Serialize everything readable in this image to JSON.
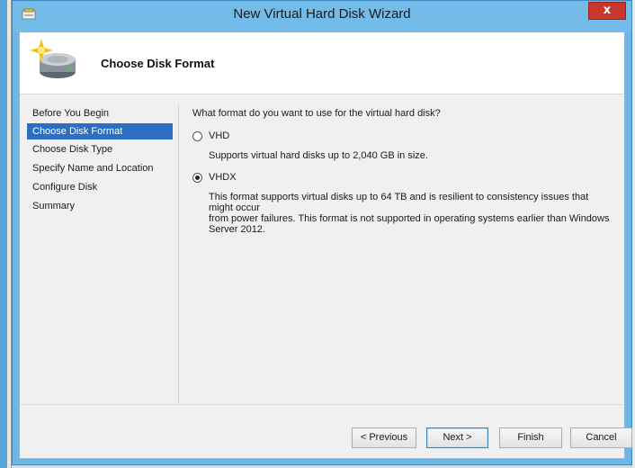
{
  "window": {
    "title": "New Virtual Hard Disk Wizard",
    "close_label": "x"
  },
  "header": {
    "title": "Choose Disk Format",
    "icon": "virtual-disk-sparkle-icon"
  },
  "nav": {
    "items": [
      {
        "label": "Before You Begin"
      },
      {
        "label": "Choose Disk Format"
      },
      {
        "label": "Choose Disk Type"
      },
      {
        "label": "Specify Name and Location"
      },
      {
        "label": "Configure Disk"
      },
      {
        "label": "Summary"
      }
    ],
    "active": "Choose Disk Format"
  },
  "content": {
    "question": "What format do you want to use for the virtual hard disk?",
    "options": [
      {
        "label": "VHD",
        "selected": false,
        "description": "Supports virtual hard disks up to 2,040 GB in size."
      },
      {
        "label": "VHDX",
        "selected": true,
        "description_lines": [
          "This format supports virtual disks up to 64 TB and is resilient to consistency issues that might occur",
          "from power failures. This format is not supported in operating systems earlier than Windows",
          "Server 2012."
        ]
      }
    ]
  },
  "buttons": {
    "previous": "< Previous",
    "next": "Next >",
    "finish": "Finish",
    "cancel": "Cancel"
  },
  "colors": {
    "title_bar": "#73bbe9",
    "nav_active": "#2b6ec2",
    "close_button": "#c7372b"
  }
}
